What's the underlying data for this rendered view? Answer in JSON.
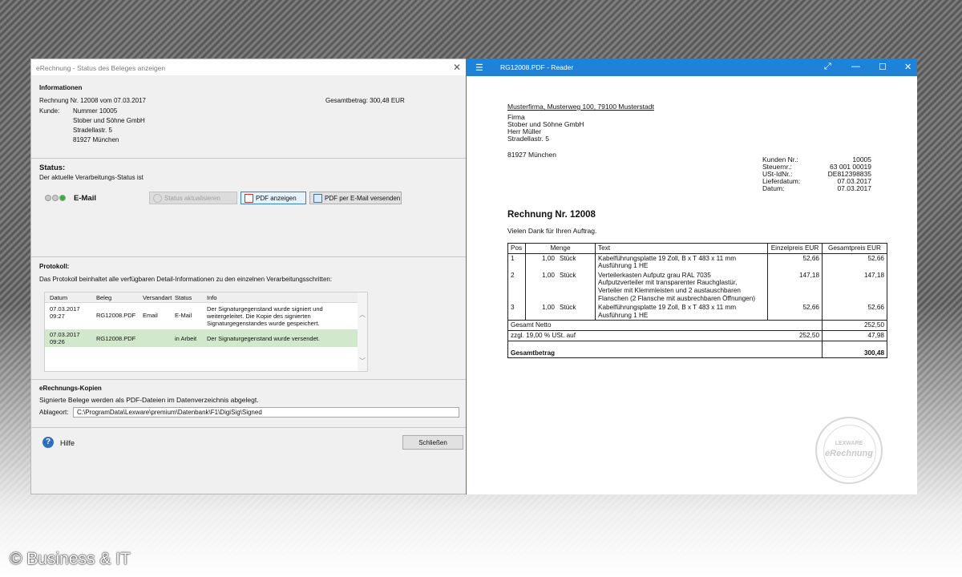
{
  "dialog": {
    "title": "eRechnung - Status des Beleges anzeigen",
    "close_glyph": "✕",
    "info": {
      "heading": "Informationen",
      "invoice_line": "Rechnung Nr. 12008 vom 07.03.2017",
      "total": "Gesamtbetrag: 300,48 EUR",
      "customer_label": "Kunde:",
      "customer_lines": [
        "Nummer  10005",
        "Stober und Söhne GmbH",
        "Stradellastr. 5",
        "81927 München"
      ]
    },
    "status": {
      "heading": "Status:",
      "desc": "Der aktuelle Verarbeitungs-Status ist",
      "value": "E-Mail",
      "light_colors": [
        "#c8c8c8",
        "#c8c8c8",
        "#2db82d"
      ],
      "btn_update": "Status aktualisieren",
      "btn_pdf": "PDF anzeigen",
      "btn_email": "PDF per E-Mail versenden"
    },
    "protocol": {
      "heading": "Protokoll:",
      "desc": "Das Protokoll beinhaltet alle verfügbaren Detail-Informationen zu den einzelnen Verarbeitungsschritten:",
      "columns": [
        "Datum",
        "Beleg",
        "Versandart",
        "Status",
        "Info"
      ],
      "rows": [
        {
          "date": "07.03.2017\n09:27",
          "doc": "RG12008.PDF",
          "method": "Email",
          "status": "E-Mail",
          "info": "Der Signaturgegenstand wurde signiert und weitergeleitet. Die Kopie des signierten Signaturgegenstandes wurde gespeichert."
        },
        {
          "date": "07.03.2017\n09:26",
          "doc": "RG12008.PDF",
          "method": "",
          "status": "in Arbeit",
          "info": "Der Signaturgegenstand wurde versendet."
        }
      ]
    },
    "copies": {
      "heading": "eRechnungs-Kopien",
      "desc": "Signierte Belege werden als PDF-Dateien im Datenverzeichnis abgelegt.",
      "path_label": "Ablageort:",
      "path_value": "C:\\ProgramData\\Lexware\\premium\\Datenbank\\F1\\DigiSig\\Signed"
    },
    "help_label": "Hilfe",
    "close_label": "Schließen"
  },
  "reader": {
    "title": "RG12008.PDF - Reader",
    "sender_line": "Musterfirma, Musterweg 100, 79100 Musterstadt",
    "address": [
      "Firma",
      "Stober und Söhne GmbH",
      "Herr Müller",
      "Stradellastr. 5"
    ],
    "city": "81927 München",
    "meta_labels": [
      "Kunden Nr.:",
      "Steuernr.:",
      "USt-IdNr.:",
      "Lieferdatum:",
      "Datum:"
    ],
    "meta_values": [
      "10005",
      "63  001  00019",
      "DE812398835",
      "07.03.2017",
      "07.03.2017"
    ],
    "heading": "Rechnung Nr. 12008",
    "thanks": "Vielen Dank für Ihren Auftrag.",
    "table": {
      "h_pos": "Pos",
      "h_qty": "Menge",
      "h_text": "Text",
      "h_unit": "Einzelpreis EUR",
      "h_total": "Gesamtpreis EUR",
      "rows": [
        {
          "pos": "1",
          "qty": "1,00",
          "unit_name": "Stück",
          "text": "Kabelführungsplatte 19 Zoll,  B x T 483 x 11 mm\nAusführung 1 HE",
          "price": "52,66",
          "total": "52,66"
        },
        {
          "pos": "2",
          "qty": "1,00",
          "unit_name": "Stück",
          "text": "Verteilerkasten Aufputz grau RAL 7035\nAufputzverteiler mit transparenter Rauchglastür,\nVerteiler mit Klemmleisten und 2 austauschbaren\nFlanschen (2 Flansche mit ausbrechbaren Öffnungen)",
          "price": "147,18",
          "total": "147,18"
        },
        {
          "pos": "3",
          "qty": "1,00",
          "unit_name": "Stück",
          "text": "Kabelführungsplatte 19 Zoll,  B x T 483 x 11 mm\nAusführung 1 HE",
          "price": "52,66",
          "total": "52,66"
        }
      ],
      "net_label": "Gesamt Netto",
      "net_value": "252,50",
      "vat_label": "zzgl. 19,00 % USt. auf",
      "vat_base": "252,50",
      "vat_value": "47,98",
      "gross_label": "Gesamtbetrag",
      "gross_value": "300,48"
    },
    "seal": {
      "line1": "LEXWARE",
      "line2": "eRechnung"
    }
  },
  "copyright": "© Business & IT"
}
